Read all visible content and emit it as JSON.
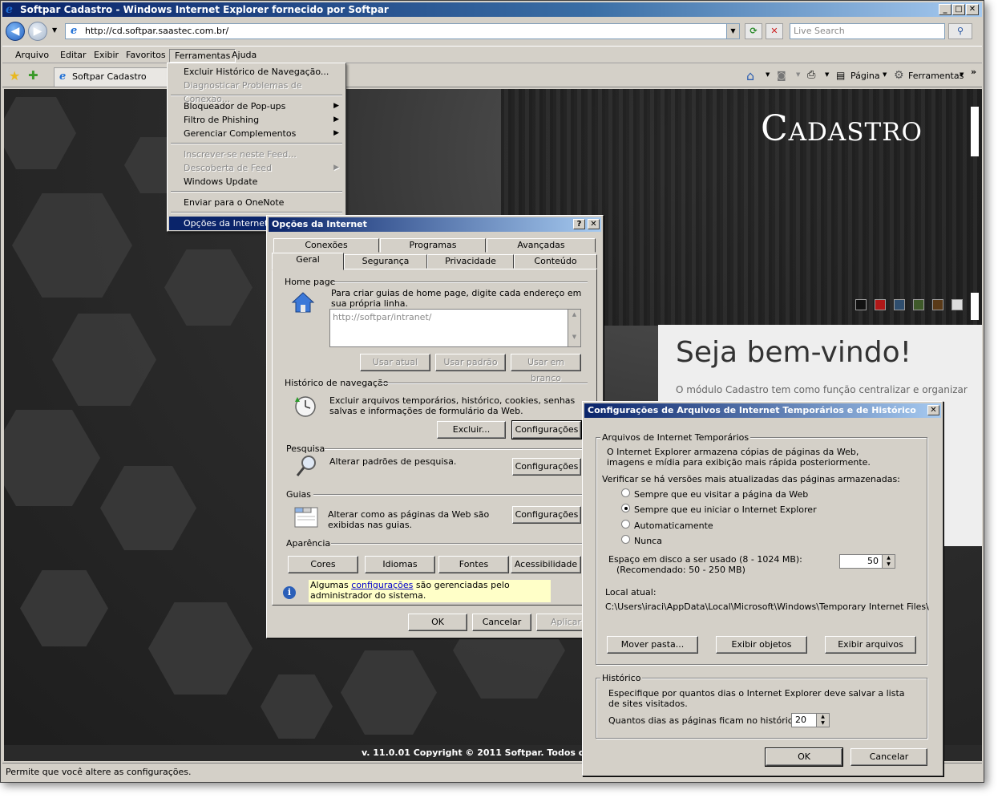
{
  "window": {
    "title": "Softpar Cadastro - Windows Internet Explorer fornecido por Softpar",
    "minimize": "_",
    "maximize": "□",
    "close": "✕"
  },
  "address": {
    "url": "http://cd.softpar.saastec.com.br/",
    "search_placeholder": "Live Search"
  },
  "menubar": {
    "items": [
      "Arquivo",
      "Editar",
      "Exibir",
      "Favoritos",
      "Ferramentas",
      "Ajuda"
    ]
  },
  "favbar": {
    "tab_title": "Softpar Cadastro",
    "pagina": "Página",
    "ferramentas": "Ferramentas"
  },
  "tools_menu": {
    "items": [
      {
        "label": "Excluir Histórico de Navegação...",
        "enabled": true
      },
      {
        "label": "Diagnosticar Problemas de Conexão...",
        "enabled": false
      },
      {
        "label": "Bloqueador de Pop-ups",
        "enabled": true,
        "submenu": true
      },
      {
        "label": "Filtro de Phishing",
        "enabled": true,
        "submenu": true
      },
      {
        "label": "Gerenciar Complementos",
        "enabled": true,
        "submenu": true
      },
      {
        "label": "Inscrever-se neste Feed...",
        "enabled": false
      },
      {
        "label": "Descoberta de Feed",
        "enabled": false,
        "submenu": true
      },
      {
        "label": "Windows Update",
        "enabled": true
      },
      {
        "label": "Enviar para o OneNote",
        "enabled": true
      },
      {
        "label": "Opções da Internet",
        "enabled": true,
        "selected": true
      }
    ]
  },
  "page": {
    "logo": "Cadastro",
    "welcome_title": "Seja bem-vindo!",
    "welcome_text": "O módulo Cadastro tem como função centralizar e organizar",
    "footer": "v. 11.0.01 Copyright © 2011 Softpar. Todos os direitos",
    "swatches": [
      "#111111",
      "#b01818",
      "#2f4e6e",
      "#3f5a2a",
      "#5a3a18",
      "#dcdcdc"
    ]
  },
  "status": "Permite que você altere as configurações.",
  "internet_options": {
    "title": "Opções da Internet",
    "help": "?",
    "close": "✕",
    "tabs_row1": [
      "Conexões",
      "Programas",
      "Avançadas"
    ],
    "tabs_row2": [
      "Geral",
      "Segurança",
      "Privacidade",
      "Conteúdo"
    ],
    "home_group": "Home page",
    "home_desc": "Para criar guias de home page, digite cada endereço em sua própria linha.",
    "home_url": "http://softpar/intranet/",
    "btn_usar_atual": "Usar atual",
    "btn_usar_padrao": "Usar padrão",
    "btn_usar_branco": "Usar em branco",
    "history_group": "Histórico de navegação",
    "history_desc": "Excluir arquivos temporários, histórico, cookies, senhas salvas e informações de formulário da Web.",
    "btn_excluir": "Excluir...",
    "btn_config1": "Configurações",
    "search_group": "Pesquisa",
    "search_desc": "Alterar padrões de pesquisa.",
    "btn_config2": "Configurações",
    "tabs_group": "Guias",
    "tabs_desc": "Alterar como as páginas da Web são exibidas nas guias.",
    "btn_config3": "Configurações",
    "appearance_group": "Aparência",
    "btn_cores": "Cores",
    "btn_idiomas": "Idiomas",
    "btn_fontes": "Fontes",
    "btn_acess": "Acessibilidade",
    "admin_note_pre": "Algumas ",
    "admin_note_link": "configurações",
    "admin_note_post": " são gerenciadas pelo administrador do sistema.",
    "ok": "OK",
    "cancel": "Cancelar",
    "apply": "Aplicar"
  },
  "temp_files": {
    "title": "Configurações de Arquivos de Internet Temporários e de Histórico",
    "close": "✕",
    "group1": "Arquivos de Internet Temporários",
    "desc1": "O Internet Explorer armazena cópias de páginas da Web, imagens e mídia para exibição mais rápida posteriormente.",
    "check_label": "Verificar se há versões mais atualizadas das páginas armazenadas:",
    "radios": [
      {
        "label": "Sempre que eu visitar a página da Web",
        "checked": false
      },
      {
        "label": "Sempre que eu iniciar o Internet Explorer",
        "checked": true
      },
      {
        "label": "Automaticamente",
        "checked": false
      },
      {
        "label": "Nunca",
        "checked": false
      }
    ],
    "disk_label": "Espaço em disco a ser usado (8 - 1024 MB):",
    "disk_rec": "(Recomendado: 50 - 250 MB)",
    "disk_value": "50",
    "local_label": "Local atual:",
    "local_path": "C:\\Users\\iraci\\AppData\\Local\\Microsoft\\Windows\\Temporary Internet Files\\",
    "btn_mover": "Mover pasta...",
    "btn_objetos": "Exibir objetos",
    "btn_arquivos": "Exibir arquivos",
    "group2": "Histórico",
    "hist_desc": "Especifique por quantos dias o Internet Explorer deve salvar a lista de sites visitados.",
    "days_label": "Quantos dias as páginas ficam no histórico:",
    "days_value": "20",
    "ok": "OK",
    "cancel": "Cancelar"
  }
}
